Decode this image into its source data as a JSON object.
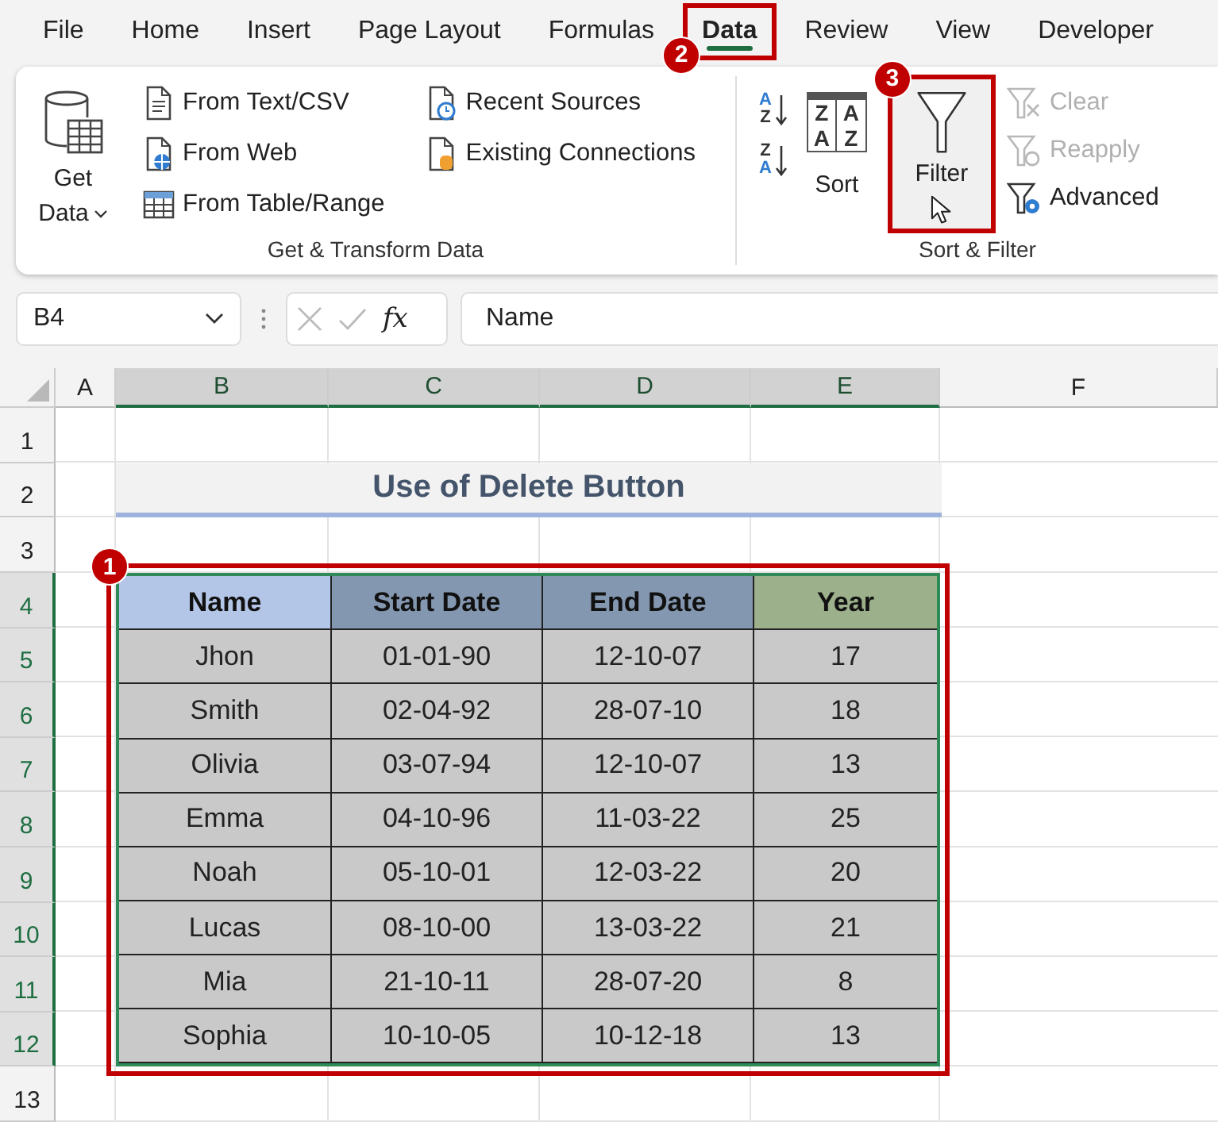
{
  "tabs": [
    {
      "label": "File",
      "selected": false
    },
    {
      "label": "Home",
      "selected": false
    },
    {
      "label": "Insert",
      "selected": false
    },
    {
      "label": "Page Layout",
      "selected": false
    },
    {
      "label": "Formulas",
      "selected": false
    },
    {
      "label": "Data",
      "selected": true,
      "callout": "2"
    },
    {
      "label": "Review",
      "selected": false
    },
    {
      "label": "View",
      "selected": false
    },
    {
      "label": "Developer",
      "selected": false
    }
  ],
  "ribbon": {
    "get_transform": {
      "get_data": [
        "Get",
        "Data"
      ],
      "items": [
        {
          "label": "From Text/CSV",
          "kind": "text-file"
        },
        {
          "label": "From Web",
          "kind": "web"
        },
        {
          "label": "From Table/Range",
          "kind": "table"
        },
        {
          "label": "Recent Sources",
          "kind": "recent"
        },
        {
          "label": "Existing Connections",
          "kind": "connections"
        }
      ],
      "label": "Get & Transform Data"
    },
    "sort_filter": {
      "sort_ascending_letters": [
        "A",
        "Z"
      ],
      "sort_descending_letters": [
        "Z",
        "A"
      ],
      "sort_letters": [
        "Z",
        "A",
        "A",
        "Z"
      ],
      "sort": "Sort",
      "filter": {
        "label": "Filter",
        "callout": "3"
      },
      "items": [
        {
          "label": "Clear",
          "kind": "clear",
          "disabled": true
        },
        {
          "label": "Reapply",
          "kind": "reapply",
          "disabled": true
        },
        {
          "label": "Advanced",
          "kind": "advanced",
          "disabled": false
        }
      ],
      "label": "Sort & Filter"
    }
  },
  "formula_bar": {
    "name_box": "B4",
    "function_label": "fx",
    "formula": "Name"
  },
  "grid": {
    "columns": [
      {
        "label": "A",
        "selected": false
      },
      {
        "label": "B",
        "selected": true
      },
      {
        "label": "C",
        "selected": true
      },
      {
        "label": "D",
        "selected": true
      },
      {
        "label": "E",
        "selected": true
      },
      {
        "label": "F",
        "selected": false
      }
    ],
    "rows": [
      {
        "label": "1",
        "selected": false
      },
      {
        "label": "2",
        "selected": false
      },
      {
        "label": "3",
        "selected": false
      },
      {
        "label": "4",
        "selected": true
      },
      {
        "label": "5",
        "selected": true
      },
      {
        "label": "6",
        "selected": true
      },
      {
        "label": "7",
        "selected": true
      },
      {
        "label": "8",
        "selected": true
      },
      {
        "label": "9",
        "selected": true
      },
      {
        "label": "10",
        "selected": true
      },
      {
        "label": "11",
        "selected": true
      },
      {
        "label": "12",
        "selected": true
      },
      {
        "label": "13",
        "selected": false
      }
    ]
  },
  "title": "Use of Delete Button",
  "table": {
    "callout": "1",
    "columns": [
      {
        "label": "Name",
        "color": "#b4c6e7"
      },
      {
        "label": "Start Date",
        "color": "#8497b0"
      },
      {
        "label": "End Date",
        "color": "#8497b0"
      },
      {
        "label": "Year",
        "color": "#9bb08b"
      }
    ],
    "rows": [
      [
        "Jhon",
        "01-01-90",
        "12-10-07",
        "17"
      ],
      [
        "Smith",
        "02-04-92",
        "28-07-10",
        "18"
      ],
      [
        "Olivia",
        "03-07-94",
        "12-10-07",
        "13"
      ],
      [
        "Emma",
        "04-10-96",
        "11-03-22",
        "25"
      ],
      [
        "Noah",
        "05-10-01",
        "12-03-22",
        "20"
      ],
      [
        "Lucas",
        "08-10-00",
        "13-03-22",
        "21"
      ],
      [
        "Mia",
        "21-10-11",
        "28-07-20",
        "8"
      ],
      [
        "Sophia",
        "10-10-05",
        "10-12-18",
        "13"
      ]
    ]
  }
}
